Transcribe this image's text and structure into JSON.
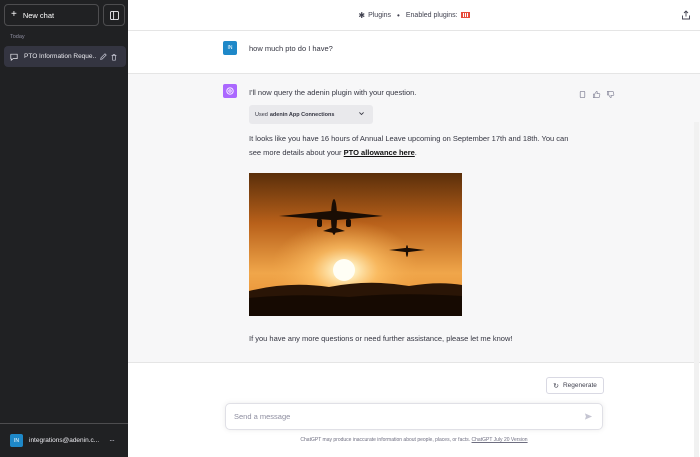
{
  "sidebar": {
    "new_chat_label": "New chat",
    "section_label": "Today",
    "chat_items": [
      {
        "label": "PTO Information Reque..."
      }
    ],
    "user_initials": "IN",
    "user_email": "integrations@adenin.c...",
    "more_label": "···"
  },
  "topbar": {
    "plugins_label": "Plugins",
    "separator": "•",
    "enabled_label": "Enabled plugins:"
  },
  "conversation": {
    "user_initials": "IN",
    "user_message": "how much pto do I have?",
    "bot_intro": "I'll now query the adenin plugin with your question.",
    "plugin_used_prefix": "Used",
    "plugin_used_name": "adenin App Connections",
    "bot_answer_text": "It looks like you have 16 hours of Annual Leave upcoming on September 17th and 18th. You can see more details about your",
    "bot_answer_link": "PTO allowance here",
    "bot_answer_end": ".",
    "bot_followup": "If you have any more questions or need further assistance, please let me know!"
  },
  "footer": {
    "regenerate_label": "Regenerate",
    "input_placeholder": "Send a message",
    "disclaimer_text": "ChatGPT may produce inaccurate information about people, places, or facts.",
    "version_link": "ChatGPT July 20 Version"
  },
  "colors": {
    "sidebar_bg": "#202123",
    "bot_avatar": "#ab68ff",
    "user_avatar": "#1e88c8"
  }
}
